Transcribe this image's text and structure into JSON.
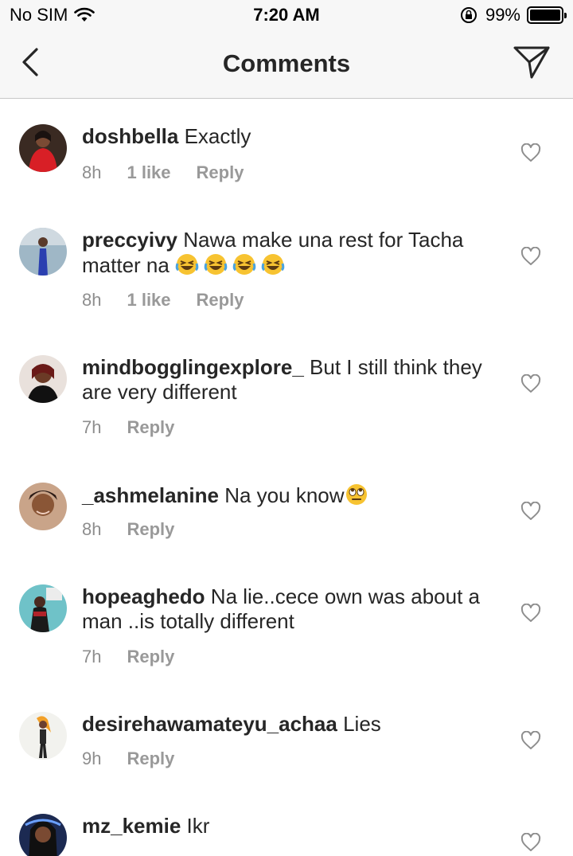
{
  "status_bar": {
    "carrier": "No SIM",
    "time": "7:20 AM",
    "battery": "99%",
    "battery_level": 0.99
  },
  "nav": {
    "title": "Comments",
    "back_icon": "chevron-left-icon",
    "send_icon": "direct-send-icon"
  },
  "comments": [
    {
      "user": "doshbella",
      "text": "Exactly",
      "time": "8h",
      "likes": "1 like",
      "reply": "Reply"
    },
    {
      "user": "preccyivy",
      "text": "Nawa make una rest for Tacha matter na",
      "emoji": "😂😂😂😂",
      "time": "8h",
      "likes": "1 like",
      "reply": "Reply"
    },
    {
      "user": "mindbogglingexplore_",
      "text": "But I still think they are very different",
      "time": "7h",
      "reply": "Reply"
    },
    {
      "user": "_ashmelanine",
      "text": "Na you know",
      "emoji": "🙄",
      "time": "8h",
      "reply": "Reply"
    },
    {
      "user": "hopeaghedo",
      "text": "Na lie..cece own was about a man ..is totally different",
      "time": "7h",
      "reply": "Reply"
    },
    {
      "user": "desirehawamateyu_achaa",
      "text": "Lies",
      "time": "9h",
      "reply": "Reply"
    },
    {
      "user": "mz_kemie",
      "text": "Ikr"
    }
  ],
  "colors": {
    "bar_bg": "#f7f7f7",
    "text": "#262626",
    "secondary": "#8e8e8e"
  }
}
